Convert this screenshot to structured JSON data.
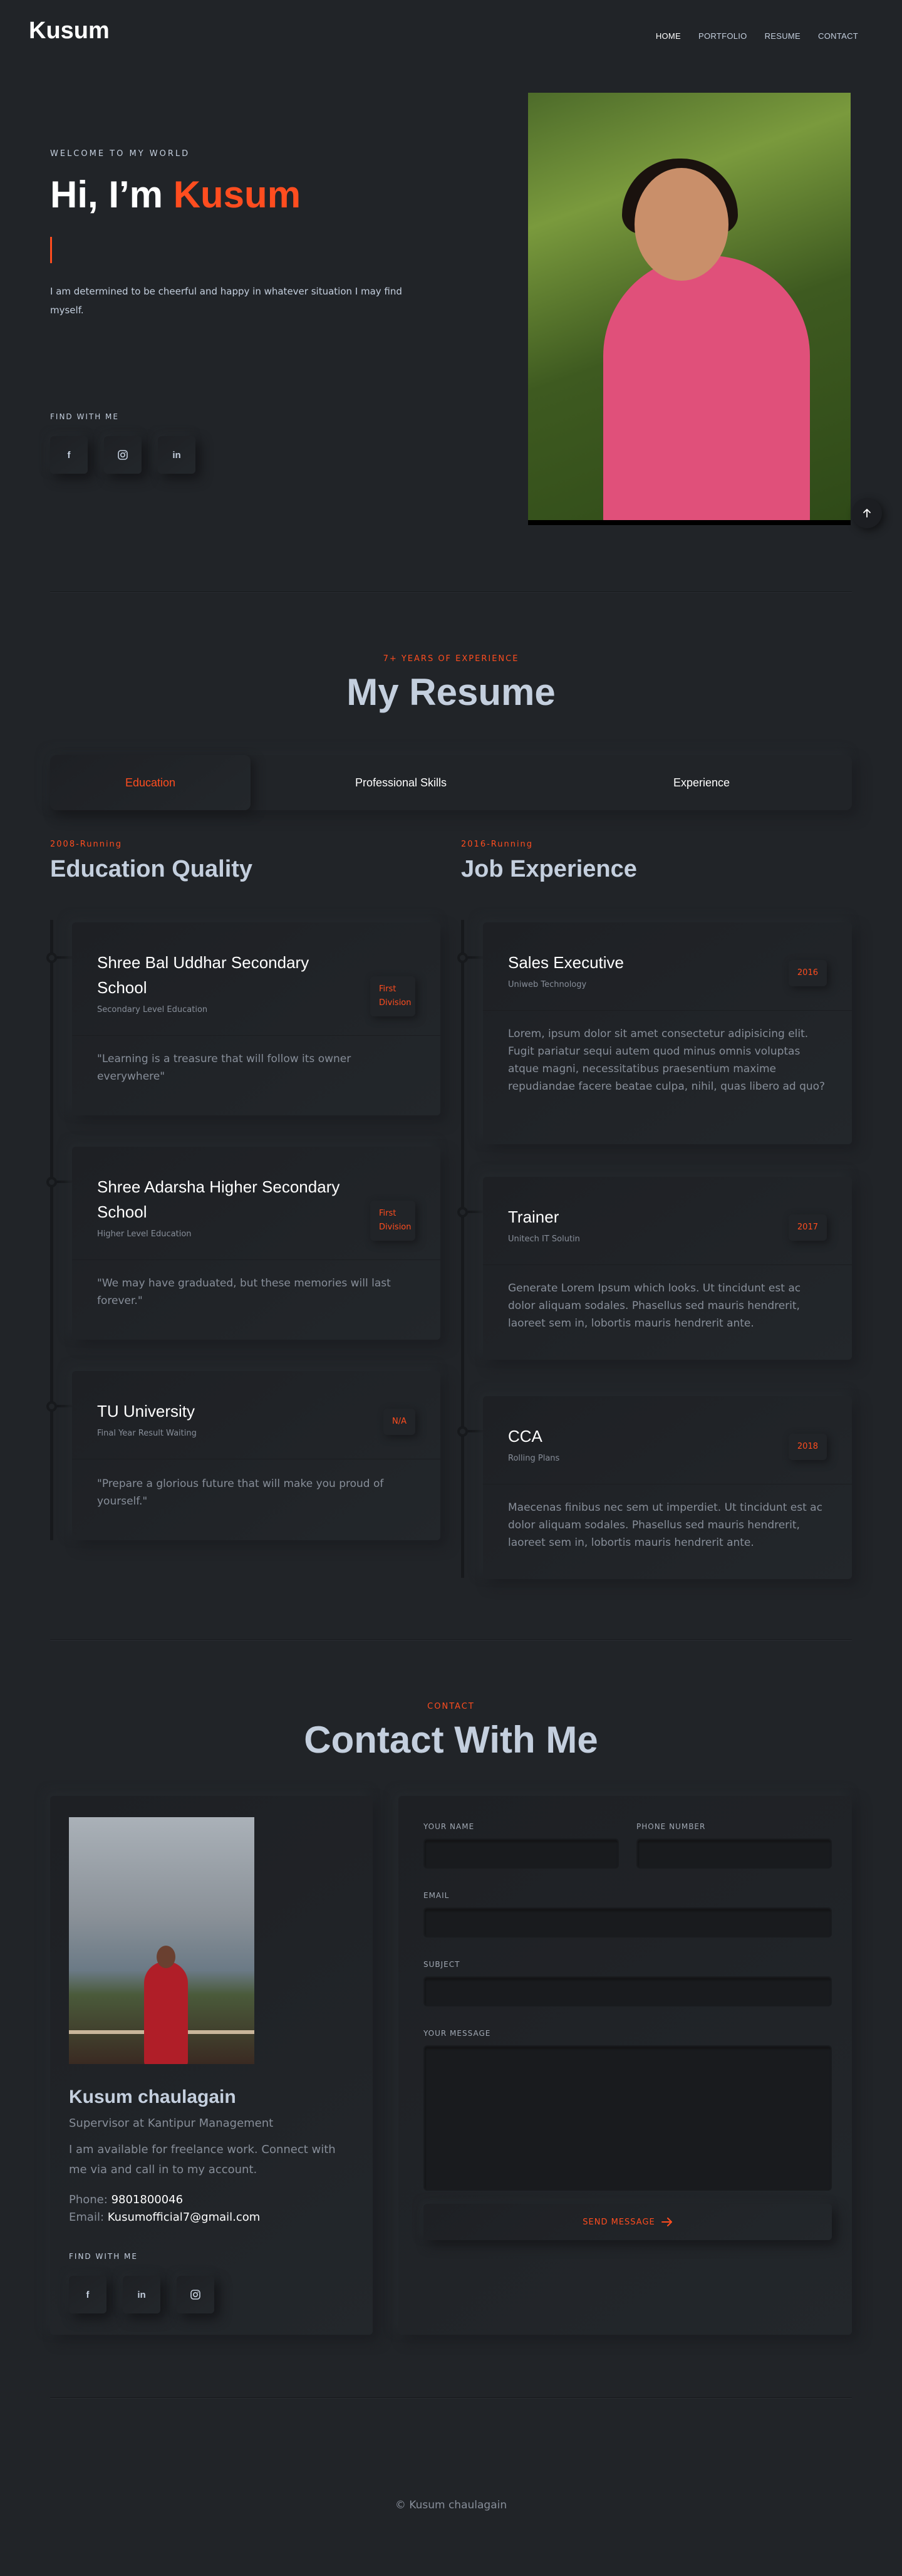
{
  "header": {
    "brand": "Kusum",
    "nav": [
      "HOME",
      "PORTFOLIO",
      "RESUME",
      "CONTACT"
    ]
  },
  "hero": {
    "welcome": "WELCOME TO MY WORLD",
    "greeting": "Hi, I’m",
    "name": "Kusum",
    "description": "I am determined to be cheerful and happy in whatever situation I may find myself.",
    "find_label": "FIND WITH ME",
    "socials": [
      "facebook-icon",
      "instagram-icon",
      "linkedin-icon"
    ]
  },
  "resume": {
    "eyebrow": "7+ YEARS OF EXPERIENCE",
    "title": "My Resume",
    "tabs": [
      "Education",
      "Professional Skills",
      "Experience"
    ],
    "active_tab": "Education",
    "education": {
      "eyebrow": "2008-Running",
      "title": "Education Quality",
      "items": [
        {
          "title": "Shree Bal Uddhar Secondary School",
          "sub": "Secondary Level Education",
          "badge": "First Division",
          "text": "\"Learning is a treasure that will follow its owner everywhere\""
        },
        {
          "title": "Shree Adarsha Higher Secondary School",
          "sub": "Higher Level Education",
          "badge": "First Division",
          "text": "\"We may have graduated, but these memories will last forever.\""
        },
        {
          "title": "TU University",
          "sub": "Final Year Result Waiting",
          "badge": "N/A",
          "text": "\"Prepare a glorious future that will make you proud of yourself.\""
        }
      ]
    },
    "experience": {
      "eyebrow": "2016-Running",
      "title": "Job Experience",
      "items": [
        {
          "title": "Sales Executive",
          "sub": "Uniweb Technology",
          "badge": "2016",
          "text": "Lorem, ipsum dolor sit amet consectetur adipisicing elit. Fugit pariatur sequi autem quod minus omnis voluptas atque magni, necessitatibus praesentium maxime repudiandae facere beatae culpa, nihil, quas libero ad quo?"
        },
        {
          "title": "Trainer",
          "sub": "Unitech IT Solutin",
          "badge": "2017",
          "text": "Generate Lorem Ipsum which looks. Ut tincidunt est ac dolor aliquam sodales. Phasellus sed mauris hendrerit, laoreet sem in, lobortis mauris hendrerit ante."
        },
        {
          "title": "CCA",
          "sub": "Rolling Plans",
          "badge": "2018",
          "text": "Maecenas finibus nec sem ut imperdiet. Ut tincidunt est ac dolor aliquam sodales. Phasellus sed mauris hendrerit, laoreet sem in, lobortis mauris hendrerit ante."
        }
      ]
    }
  },
  "contact": {
    "eyebrow": "CONTACT",
    "title": "Contact With Me",
    "name": "Kusum chaulagain",
    "role": "Supervisor at Kantipur Management",
    "description": "I am available for freelance work. Connect with me via and call in to my account.",
    "phone_label": "Phone:",
    "phone": "9801800046",
    "email_label": "Email:",
    "email": "Kusumofficial7@gmail.com",
    "find_label": "FIND WITH ME",
    "socials": [
      "facebook-icon",
      "linkedin-icon",
      "instagram-icon"
    ],
    "form": {
      "name_label": "YOUR NAME",
      "phone_label": "PHONE NUMBER",
      "email_label": "EMAIL",
      "subject_label": "SUBJECT",
      "message_label": "YOUR MESSAGE",
      "send_label": "SEND MESSAGE"
    }
  },
  "footer": {
    "text": "© Kusum chaulagain"
  },
  "colors": {
    "background": "#212428",
    "accent": "#ff4d1f",
    "heading": "#c4cfde",
    "muted": "#878e99"
  }
}
